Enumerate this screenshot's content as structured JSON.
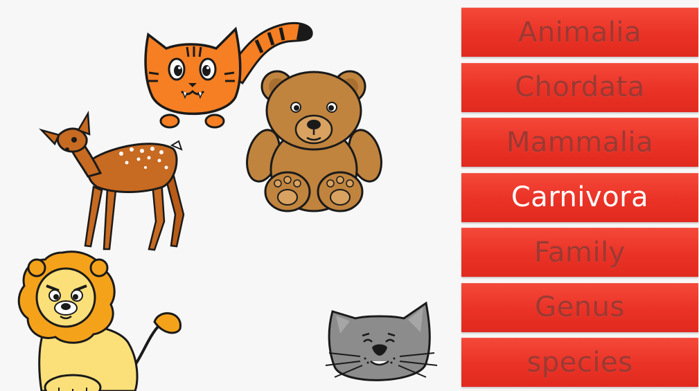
{
  "taxonomy": {
    "ranks": [
      {
        "label": "Animalia",
        "active": false
      },
      {
        "label": "Chordata",
        "active": false
      },
      {
        "label": "Mammalia",
        "active": false
      },
      {
        "label": "Carnivora",
        "active": true
      },
      {
        "label": "Family",
        "active": false
      },
      {
        "label": "Genus",
        "active": false
      },
      {
        "label": "species",
        "active": false
      }
    ]
  },
  "colors": {
    "rank_background": "#ea3226",
    "rank_text_inactive": "#9a3a33",
    "rank_text_active": "#ffffff",
    "tiger_orange": "#f57f22",
    "bear_brown": "#c0843e",
    "deer_brown": "#c76a22",
    "lion_mane": "#f5a21b",
    "lion_body": "#fbe07a",
    "cat_gray": "#8c8c8c"
  },
  "animals": [
    {
      "name": "tiger-cat-icon"
    },
    {
      "name": "teddy-bear-icon"
    },
    {
      "name": "deer-icon"
    },
    {
      "name": "lion-icon"
    },
    {
      "name": "gray-cat-icon"
    }
  ]
}
